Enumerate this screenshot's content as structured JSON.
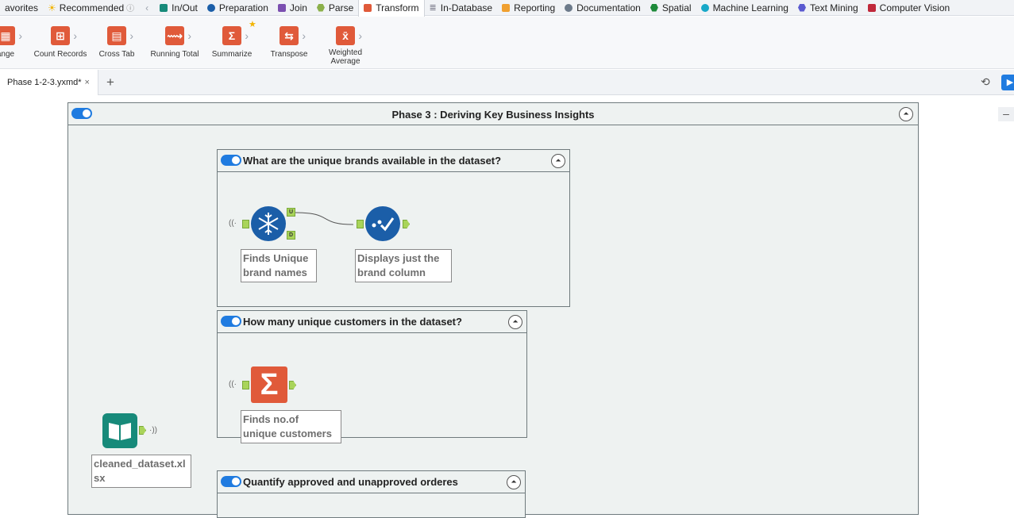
{
  "categories": {
    "favorites": "avorites",
    "recommended": "Recommended",
    "inout": "In/Out",
    "preparation": "Preparation",
    "join": "Join",
    "parse": "Parse",
    "transform": "Transform",
    "indatabase": "In-Database",
    "reporting": "Reporting",
    "documentation": "Documentation",
    "spatial": "Spatial",
    "ml": "Machine Learning",
    "textmining": "Text Mining",
    "cv": "Computer Vision"
  },
  "colors": {
    "accent": "#1f7be0",
    "transform": "#e05a3a",
    "connector": "#a9d45a"
  },
  "ribbon": {
    "tools": [
      "ange",
      "Count Records",
      "Cross Tab",
      "Running Total",
      "Summarize",
      "Transpose",
      "Weighted",
      "Average"
    ]
  },
  "tabs": {
    "document": "Phase 1-2-3.yxmd*",
    "close": "×",
    "add": "+"
  },
  "canvas": {
    "main_title": "Phase 3 : Deriving Key Business Insights",
    "c1_title": "What are the unique brands available in the dataset?",
    "c1_anno1_l1": "Finds Unique",
    "c1_anno1_l2": "brand names",
    "c1_anno2_l1": "Displays  just the",
    "c1_anno2_l2": "brand column",
    "c2_title": "How many unique customers in the dataset?",
    "c2_anno_l1": "Finds no.of",
    "c2_anno_l2": "unique customers",
    "c3_title": "Quantify approved and unapproved orderes",
    "input_l1": "cleaned_dataset.xl",
    "input_l2": "sx",
    "unique_u": "U",
    "unique_d": "D"
  }
}
